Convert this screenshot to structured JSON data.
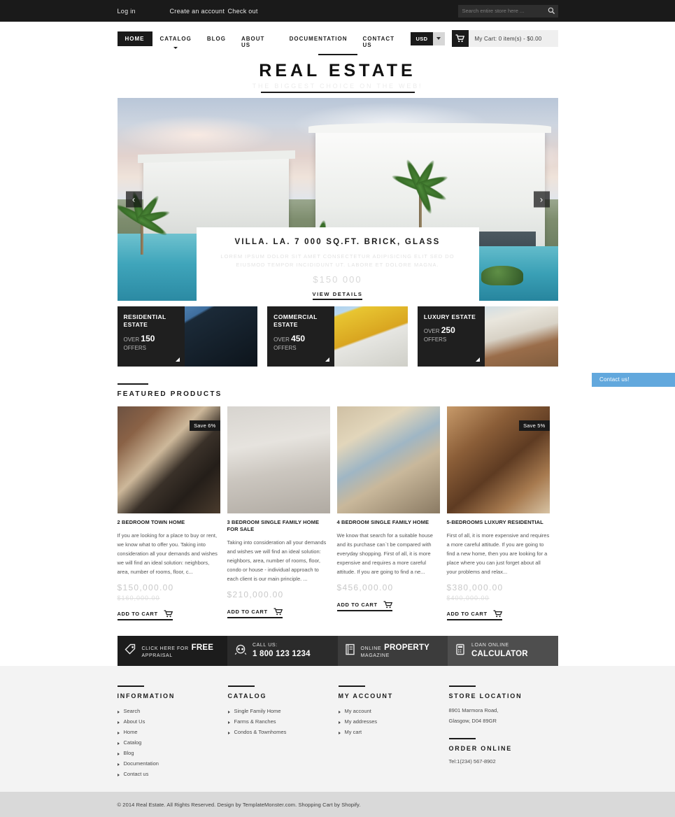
{
  "topbar": {
    "links": [
      {
        "label": "Log in"
      },
      {
        "label": "Create an account"
      },
      {
        "label": "Check out"
      }
    ],
    "search_placeholder": "Search entire store here ...",
    "search_icon": "search-icon"
  },
  "nav": {
    "items": [
      {
        "label": "HOME",
        "active": true
      },
      {
        "label": "CATALOG",
        "active": false,
        "has_dropdown": true
      },
      {
        "label": "BLOG",
        "active": false
      },
      {
        "label": "ABOUT US",
        "active": false
      },
      {
        "label": "DOCUMENTATION",
        "active": false
      },
      {
        "label": "CONTACT US",
        "active": false
      }
    ],
    "currency": "USD",
    "cart_text": "My Cart: 0 item(s) - $0.00",
    "cart_icon": "shopping-cart-icon"
  },
  "logo": {
    "title": "REAL ESTATE",
    "tagline": "THE BIGGEST CHOICE ON THE WEB!"
  },
  "hero": {
    "prev": "‹",
    "next": "›",
    "caption_title": "VILLA. LA. 7 000 SQ.FT. BRICK, GLASS",
    "caption_desc": "LOREM IPSUM DOLOR SIT AMET CONSECTETUR ADIPISICING ELIT SED DO EIUSMOD TEMPOR INCIDIDUNT UT. LABORE ET DOLORE MAGNA.",
    "caption_price": "$150 000",
    "caption_link": "VIEW DETAILS"
  },
  "categories": [
    {
      "name": "RESIDENTIAL ESTATE",
      "over": "OVER",
      "count": "150",
      "offers": "OFFERS"
    },
    {
      "name": "COMMERCIAL ESTATE",
      "over": "OVER",
      "count": "450",
      "offers": "OFFERS"
    },
    {
      "name": "LUXURY ESTATE",
      "over": "OVER",
      "count": "250",
      "offers": "OFFERS"
    }
  ],
  "featured": {
    "title": "FEATURED PRODUCTS",
    "add_to_cart": "ADD TO CART",
    "products": [
      {
        "name": "2 BEDROOM TOWN HOME",
        "badge": "Save 6%",
        "desc": "If you are looking for a place to buy or rent, we know what to offer you. Taking into consideration all your demands and wishes we will find an ideal solution: neighbors, area, number of rooms, floor, c...",
        "price": "$150,000.00",
        "old_price": "$160,000.00"
      },
      {
        "name": "3 BEDROOM SINGLE FAMILY HOME FOR SALE",
        "badge": "",
        "desc": "Taking into consideration all your demands and wishes we will find an ideal solution: neighbors, area, number of rooms, floor, condo or house - individual approach to each client is our main principle. ...",
        "price": "$210,000.00",
        "old_price": ""
      },
      {
        "name": "4 BEDROOM SINGLE FAMILY HOME",
        "badge": "",
        "desc": "We know that search for a suitable house and its purchase can`t be compared with everyday shopping. First of all, it is more expensive and requires a more careful attitude. If you are going to find a ne...",
        "price": "$456,000.00",
        "old_price": ""
      },
      {
        "name": "5-BEDROOMS LUXURY RESIDENTIAL",
        "badge": "Save 5%",
        "desc": "First of all, it is more expensive and requires a more careful attitude. If you are going to find a new home, then you are looking for a place where you can just forget about all your problems and relax...",
        "price": "$380,000.00",
        "old_price": "$400,000.00"
      }
    ]
  },
  "infobar": [
    {
      "icon": "tag-icon",
      "small": "CLICK HERE FOR",
      "big": "FREE",
      "sub": "APPRAISAL",
      "layout": "inline"
    },
    {
      "icon": "phone-icon",
      "small": "CALL US:",
      "big": "1 800 123 1234",
      "sub": "",
      "layout": "stacked"
    },
    {
      "icon": "magazine-icon",
      "small": "ONLINE",
      "big": "PROPERTY",
      "sub": "MAGAZINE",
      "layout": "inline"
    },
    {
      "icon": "calculator-icon",
      "small": "LOAN ONLINE",
      "big": "CALCULATOR",
      "sub": "",
      "layout": "stacked"
    }
  ],
  "footer": {
    "information": {
      "title": "INFORMATION",
      "items": [
        "Search",
        "About Us",
        "Home",
        "Catalog",
        "Blog",
        "Documentation",
        "Contact us"
      ]
    },
    "catalog": {
      "title": "CATALOG",
      "items": [
        "Single Family Home",
        "Farms & Ranches",
        "Condos & Townhomes"
      ]
    },
    "account": {
      "title": "MY ACCOUNT",
      "items": [
        "My account",
        "My addresses",
        "My cart"
      ]
    },
    "store": {
      "title": "STORE LOCATION",
      "address_line1": "8901 Marmora Road,",
      "address_line2": "Glasgow, D04 89GR",
      "order_title": "ORDER ONLINE",
      "tel": "Tel:1(234) 567-8902"
    },
    "copyright": "© 2014 Real Estate. All Rights Reserved. Design by TemplateMonster.com. Shopping Cart by Shopify."
  },
  "contact_tab": {
    "label": "Contact us!",
    "color": "#62a8dd"
  }
}
